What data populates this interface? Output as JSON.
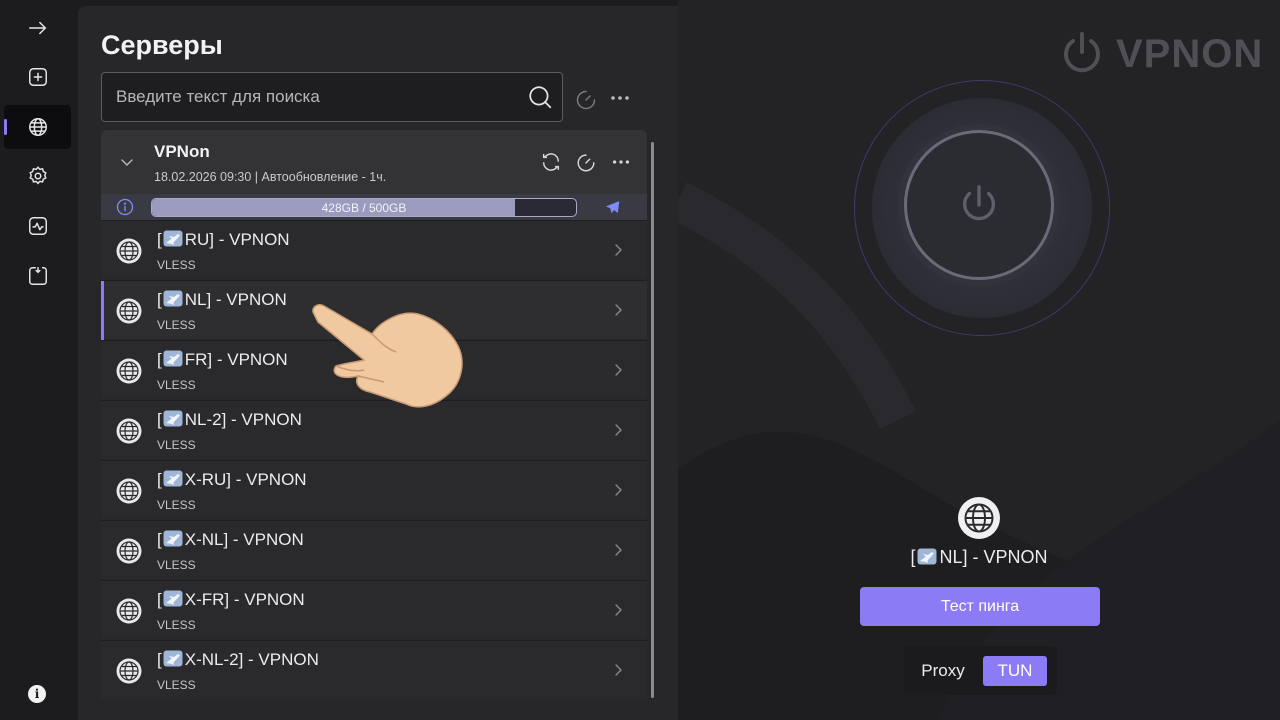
{
  "nav": {
    "items": [
      {
        "name": "connect-arrow",
        "icon": "arrow-right-icon"
      },
      {
        "name": "add-profile",
        "icon": "plus-square-icon"
      },
      {
        "name": "servers",
        "icon": "globe-icon",
        "active": true
      },
      {
        "name": "settings",
        "icon": "gear-icon"
      },
      {
        "name": "monitor",
        "icon": "activity-icon"
      },
      {
        "name": "log",
        "icon": "log-icon"
      }
    ],
    "about_icon": "i"
  },
  "servers_panel": {
    "title": "Серверы",
    "search": {
      "placeholder": "Введите текст для поиска",
      "value": ""
    },
    "group": {
      "name": "VPNon",
      "meta": "18.02.2026 09:30 | Автообновление - 1ч.",
      "quota": {
        "text": "428GB / 500GB",
        "used_fraction": 0.856
      }
    },
    "items": [
      {
        "label_pre": "[",
        "label_post": "RU] - VPNON",
        "protocol": "VLESS",
        "selected": false
      },
      {
        "label_pre": "[",
        "label_post": "NL] - VPNON",
        "protocol": "VLESS",
        "selected": true
      },
      {
        "label_pre": "[",
        "label_post": "FR] - VPNON",
        "protocol": "VLESS",
        "selected": false
      },
      {
        "label_pre": "[",
        "label_post": "NL-2] - VPNON",
        "protocol": "VLESS",
        "selected": false
      },
      {
        "label_pre": "[",
        "label_post": "X-RU] - VPNON",
        "protocol": "VLESS",
        "selected": false
      },
      {
        "label_pre": "[",
        "label_post": "X-NL] - VPNON",
        "protocol": "VLESS",
        "selected": false
      },
      {
        "label_pre": "[",
        "label_post": "X-FR] - VPNON",
        "protocol": "VLESS",
        "selected": false
      },
      {
        "label_pre": "[",
        "label_post": "X-NL-2] - VPNON",
        "protocol": "VLESS",
        "selected": false
      }
    ]
  },
  "status": {
    "logo_text": "VPNON",
    "current_server_pre": "[",
    "current_server_post": "NL] - VPNON",
    "ping_button": "Тест пинга",
    "mode": {
      "proxy_label": "Proxy",
      "tun_label": "TUN",
      "selected": "TUN"
    }
  },
  "colors": {
    "accent": "#8b7cf6",
    "panel": "#272729",
    "background": "#1c1c1f"
  }
}
